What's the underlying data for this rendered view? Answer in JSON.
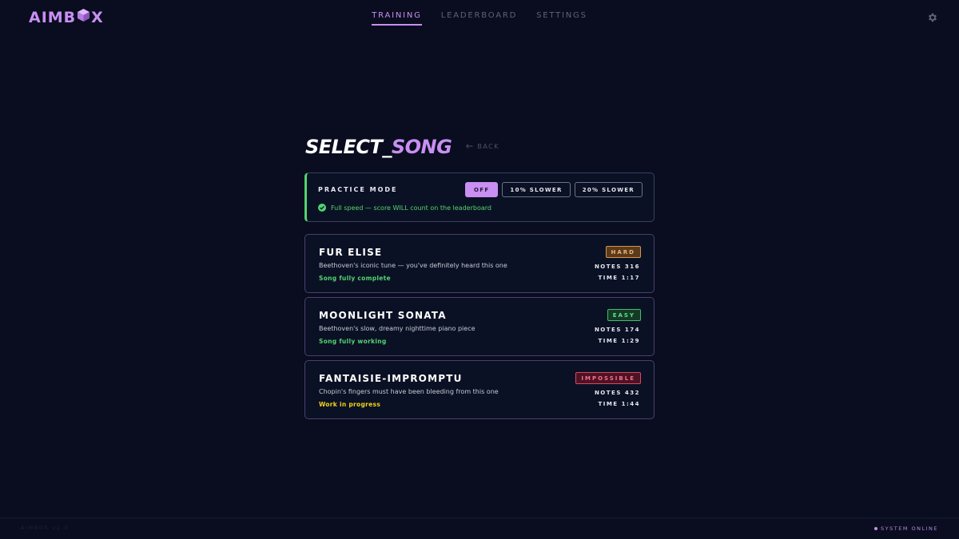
{
  "header": {
    "logo_prefix": "AIMB",
    "logo_suffix": "X",
    "nav": [
      {
        "label": "TRAINING"
      },
      {
        "label": "LEADERBOARD"
      },
      {
        "label": "SETTINGS"
      }
    ],
    "active_nav": "TRAINING"
  },
  "page": {
    "title_white": "SELECT_",
    "title_accent": "SONG",
    "back_label": "BACK"
  },
  "practice": {
    "label": "PRACTICE MODE",
    "options": [
      {
        "label": "OFF"
      },
      {
        "label": "10% SLOWER"
      },
      {
        "label": "20% SLOWER"
      }
    ],
    "selected": "OFF",
    "status": "Full speed — score WILL count on the leaderboard"
  },
  "songs": [
    {
      "title": "FUR ELISE",
      "description": "Beethoven's iconic tune — you've definitely heard this one",
      "status": "Song fully complete",
      "status_color": "#53d470",
      "difficulty": "HARD",
      "notes_label": "NOTES",
      "notes": "316",
      "time_label": "TIME",
      "time": "1:17"
    },
    {
      "title": "MOONLIGHT SONATA",
      "description": "Beethoven's slow, dreamy nighttime piano piece",
      "status": "Song fully working",
      "status_color": "#53d470",
      "difficulty": "EASY",
      "notes_label": "NOTES",
      "notes": "174",
      "time_label": "TIME",
      "time": "1:29"
    },
    {
      "title": "FANTAISIE-IMPROMPTU",
      "description": "Chopin's fingers must have been bleeding from this one",
      "status": "Work in progress",
      "status_color": "#f2d21b",
      "difficulty": "IMPOSSIBLE",
      "notes_label": "NOTES",
      "notes": "432",
      "time_label": "TIME",
      "time": "1:44"
    }
  ],
  "footer": {
    "version": "AIMBOX v1.0",
    "system_status": "SYSTEM ONLINE"
  },
  "colors": {
    "background": "#090d1f",
    "accent": "#c98ff2",
    "success": "#53d470",
    "warning": "#f2d21b"
  }
}
